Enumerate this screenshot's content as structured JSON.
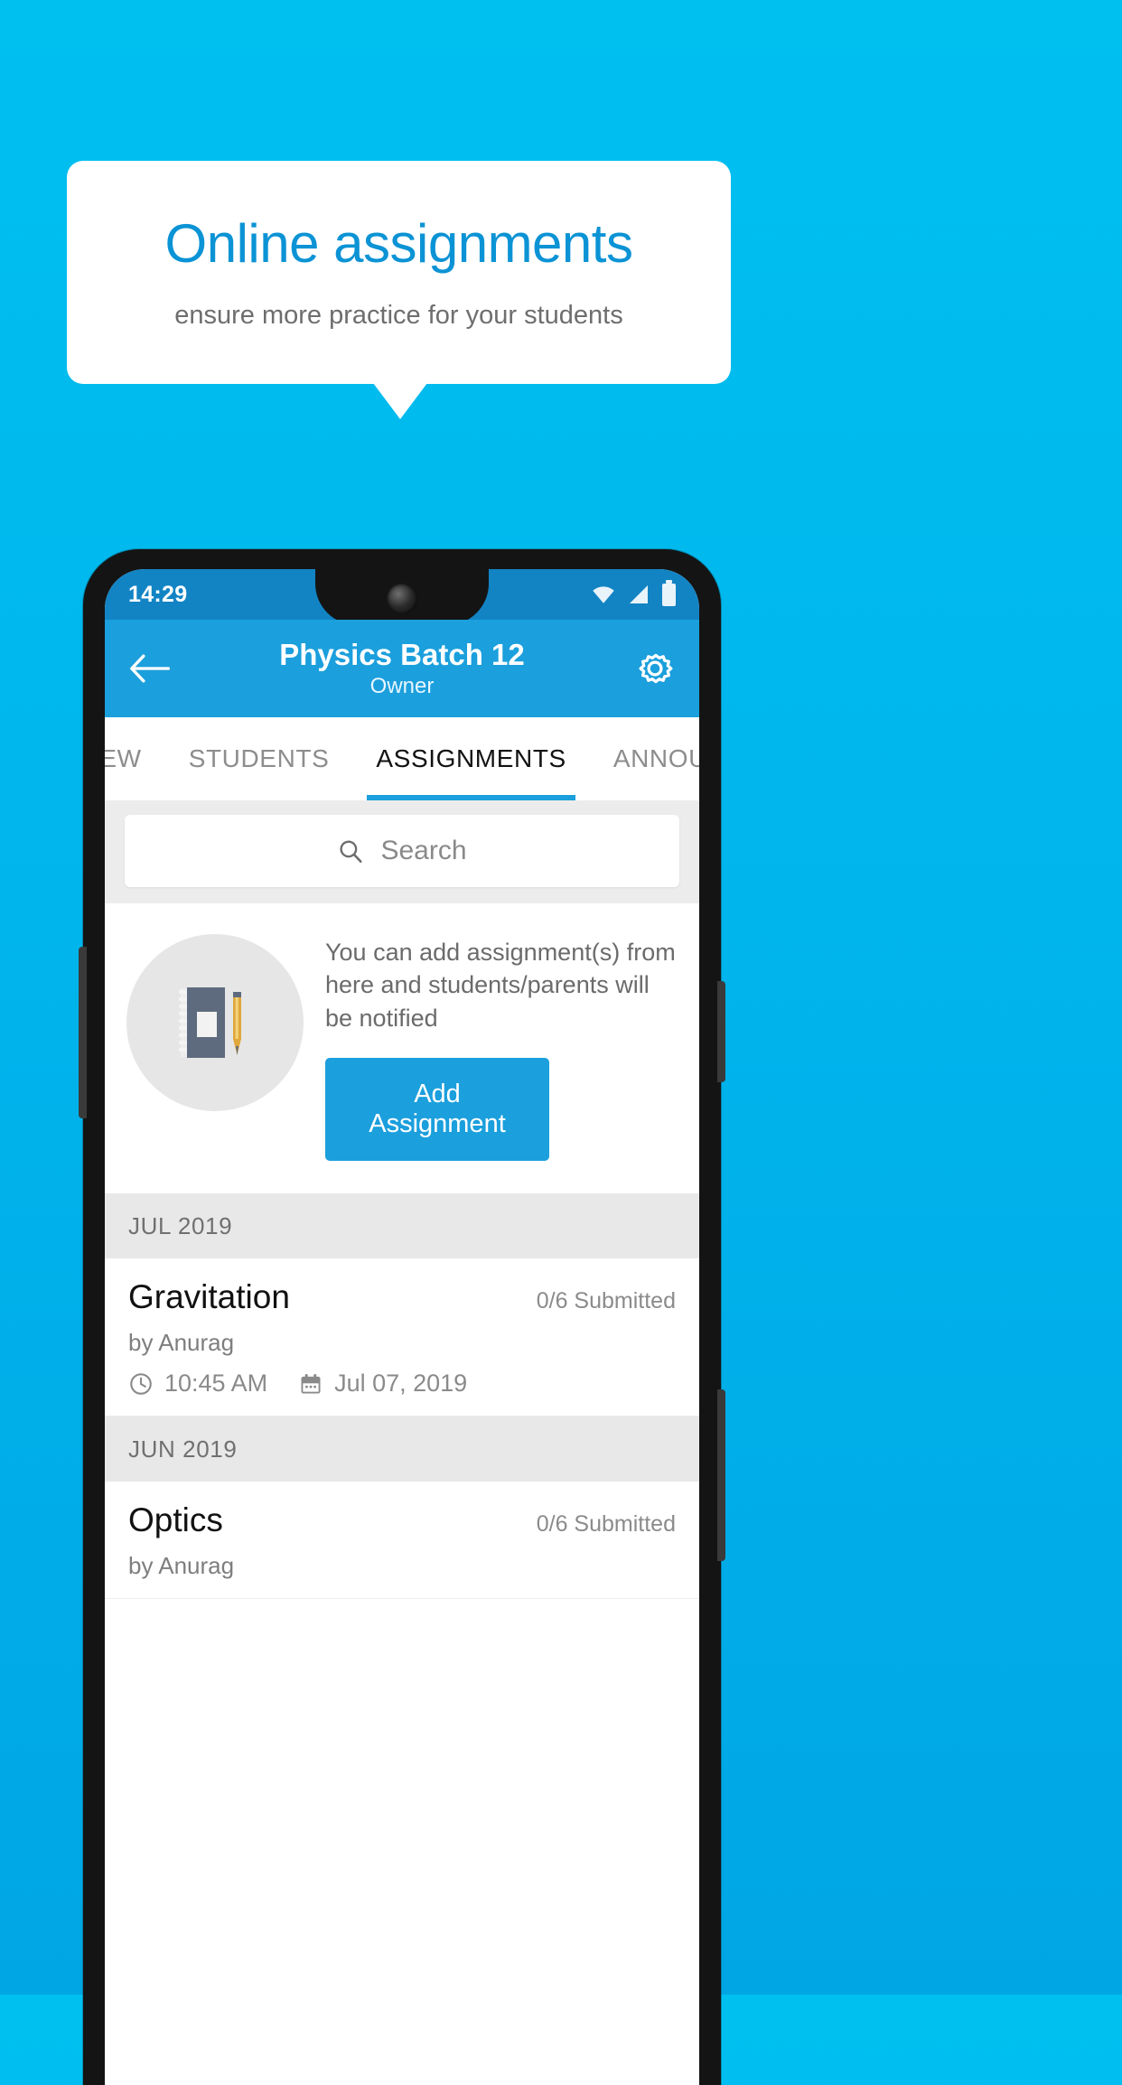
{
  "promo": {
    "title": "Online assignments",
    "subtitle": "ensure more practice for your students"
  },
  "phone": {
    "status": {
      "time": "14:29",
      "icons": [
        "wifi-icon",
        "signal-icon",
        "battery-icon"
      ]
    },
    "appbar": {
      "back_icon": "back-arrow-icon",
      "title": "Physics Batch 12",
      "subtitle": "Owner",
      "settings_icon": "gear-icon"
    },
    "tabs": [
      {
        "label": "IEW",
        "active": false
      },
      {
        "label": "STUDENTS",
        "active": false
      },
      {
        "label": "ASSIGNMENTS",
        "active": true
      },
      {
        "label": "ANNOUNCEM",
        "active": false
      }
    ],
    "search": {
      "icon": "search-icon",
      "placeholder": "Search",
      "value": ""
    },
    "empty_state": {
      "illustration": "notebook-and-pen-icon",
      "message": "You can add assignment(s) from here and students/parents will be notified",
      "button_label": "Add Assignment"
    },
    "sections": [
      {
        "month": "JUL 2019",
        "items": [
          {
            "title": "Gravitation",
            "submitted": "0/6 Submitted",
            "author": "by Anurag",
            "time": "10:45 AM",
            "date": "Jul 07, 2019",
            "time_icon": "clock-icon",
            "date_icon": "calendar-icon"
          }
        ]
      },
      {
        "month": "JUN 2019",
        "items": [
          {
            "title": "Optics",
            "submitted": "0/6 Submitted",
            "author": "by Anurag",
            "time": "",
            "date": "",
            "time_icon": "clock-icon",
            "date_icon": "calendar-icon"
          }
        ]
      }
    ]
  },
  "colors": {
    "background_top": "#00c0f0",
    "background_bottom": "#00a6e4",
    "brand_blue": "#1b9fdd",
    "title_blue": "#0b93d5",
    "statusbar_blue": "#1284c4",
    "section_grey": "#e8e8e8"
  }
}
